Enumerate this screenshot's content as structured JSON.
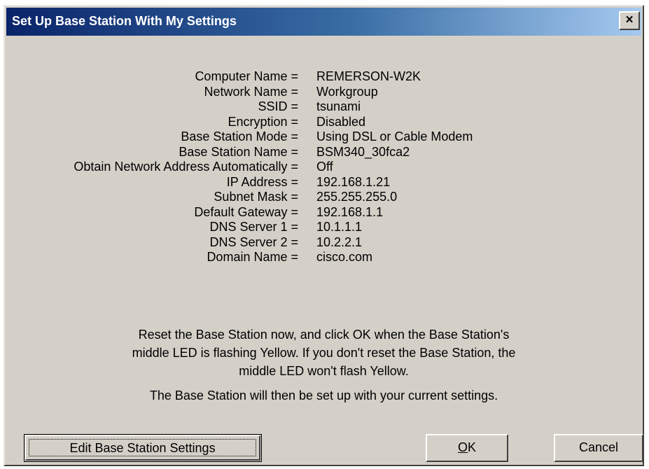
{
  "window": {
    "title": "Set Up Base Station With My Settings",
    "close_glyph": "×"
  },
  "settings": [
    {
      "label": "Computer Name =",
      "value": "REMERSON-W2K"
    },
    {
      "label": "Network Name =",
      "value": "Workgroup"
    },
    {
      "label": "SSID =",
      "value": "tsunami"
    },
    {
      "label": "Encryption =",
      "value": "Disabled"
    },
    {
      "label": "Base Station Mode =",
      "value": "Using DSL or Cable Modem"
    },
    {
      "label": "Base Station Name =",
      "value": "BSM340_30fca2"
    },
    {
      "label": "Obtain Network Address Automatically =",
      "value": "Off"
    },
    {
      "label": "IP Address =",
      "value": "192.168.1.21"
    },
    {
      "label": "Subnet Mask =",
      "value": "255.255.255.0"
    },
    {
      "label": "Default Gateway =",
      "value": "192.168.1.1"
    },
    {
      "label": "DNS Server 1 =",
      "value": "10.1.1.1"
    },
    {
      "label": "DNS Server 2 =",
      "value": "10.2.2.1"
    },
    {
      "label": "Domain Name =",
      "value": "cisco.com"
    }
  ],
  "message": {
    "line1": "Reset the Base Station now, and click OK when the Base Station's",
    "line2": "middle LED is flashing Yellow. If you don't reset the Base Station, the",
    "line3": "middle LED won't flash Yellow.",
    "followup": "The Base Station will then be set up with your current settings."
  },
  "buttons": {
    "edit_label": "Edit Base Station Settings",
    "ok_mnemonic": "O",
    "ok_rest": "K",
    "cancel_label": "Cancel"
  }
}
